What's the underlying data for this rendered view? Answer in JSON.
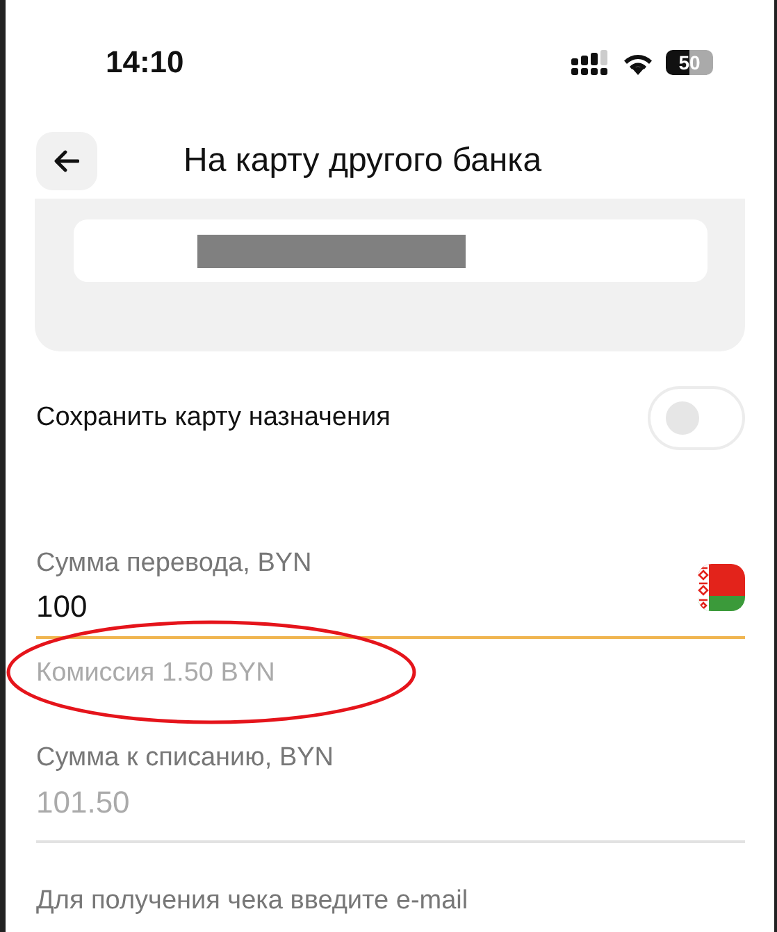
{
  "status_bar": {
    "time": "14:10",
    "battery": "50"
  },
  "header": {
    "title": "На карту другого банка"
  },
  "save_card": {
    "label": "Сохранить карту назначения",
    "on": false
  },
  "amount": {
    "label": "Сумма перевода, BYN",
    "value": "100",
    "focused": true,
    "commission": "Комиссия 1.50 BYN",
    "commission_circled": true
  },
  "debit": {
    "label": "Сумма к списанию, BYN",
    "value": "101.50"
  },
  "email": {
    "label": "Для получения чека введите e-mail"
  }
}
